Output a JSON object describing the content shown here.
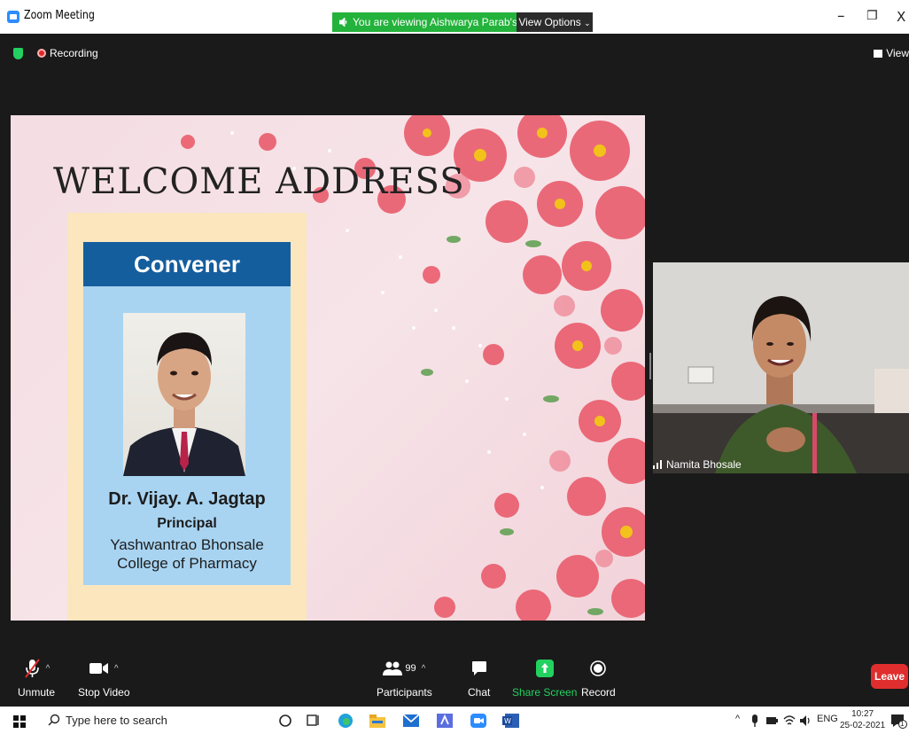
{
  "window": {
    "title": "Zoom Meeting",
    "viewing_banner": "You are viewing Aishwarya Parab's screen",
    "view_options": "View Options",
    "minimize": "–",
    "restore": "❐",
    "close": "X"
  },
  "top": {
    "recording_label": "Recording",
    "view_label": "View"
  },
  "slide": {
    "title": "WELCOME ADDRESS",
    "card_heading": "Convener",
    "name": "Dr. Vijay. A. Jagtap",
    "role": "Principal",
    "org_line1": "Yashwantrao Bhonsale",
    "org_line2": "College of Pharmacy"
  },
  "video": {
    "participant_name": "Namita Bhosale"
  },
  "toolbar": {
    "unmute": "Unmute",
    "stop_video": "Stop Video",
    "participants": "Participants",
    "participants_count": "99",
    "chat": "Chat",
    "share_screen": "Share Screen",
    "record": "Record",
    "leave": "Leave",
    "share_color": "#23d160",
    "leave_color": "#e02e2e"
  },
  "taskbar": {
    "search_placeholder": "Type here to search",
    "lang": "ENG",
    "time": "10:27",
    "date": "25-02-2021",
    "notification_count": "1"
  }
}
